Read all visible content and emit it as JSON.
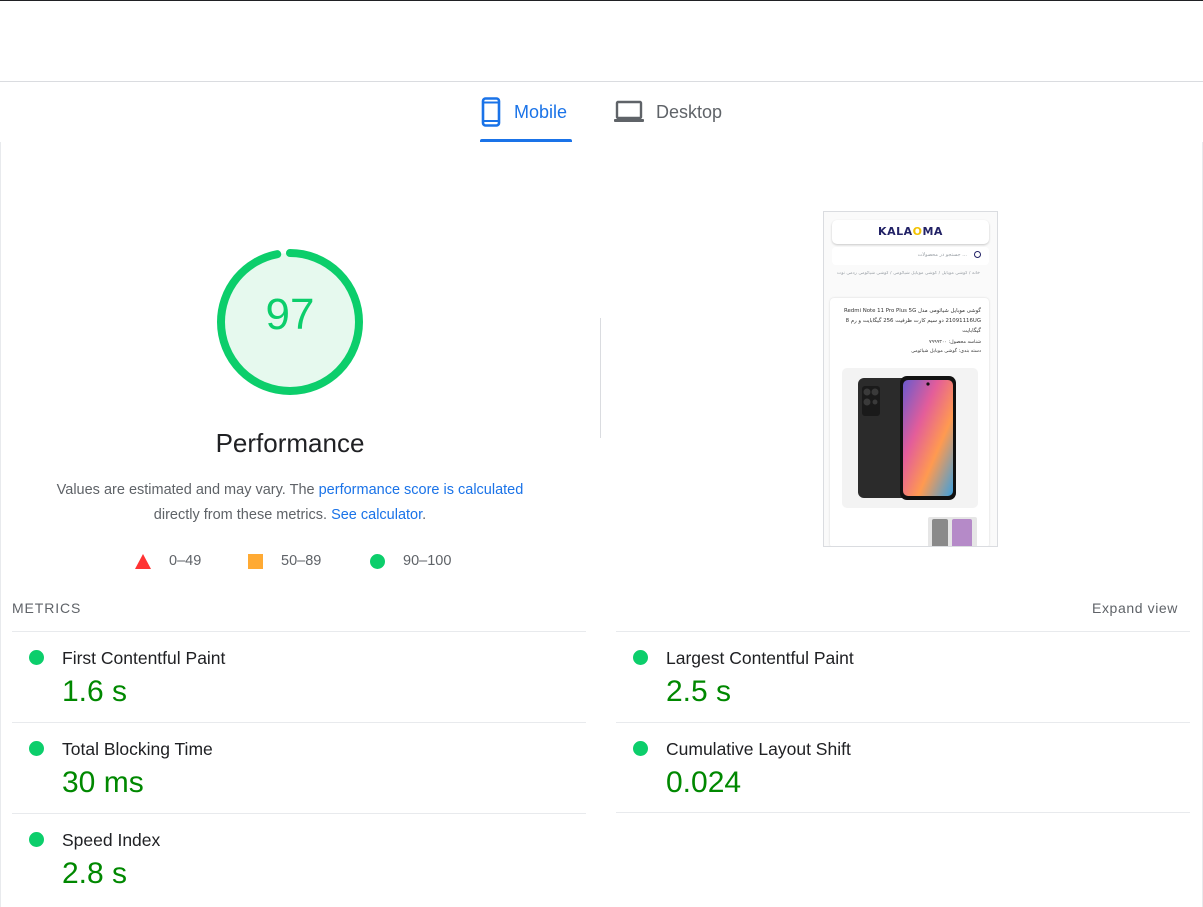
{
  "tabs": [
    {
      "label": "Mobile",
      "icon": "phone-icon",
      "active": true
    },
    {
      "label": "Desktop",
      "icon": "laptop-icon",
      "active": false
    }
  ],
  "gauge": {
    "score": "97",
    "label": "Performance",
    "color": "#0cce6b",
    "fill_fraction": 0.97
  },
  "description": {
    "part1": "Values are estimated and may vary. The ",
    "link1": "performance score is calculated",
    "part2": " directly from these metrics. ",
    "link2": "See calculator",
    "part3": "."
  },
  "legend": [
    {
      "range": "0–49",
      "shape": "triangle",
      "color": "#ff3333"
    },
    {
      "range": "50–89",
      "shape": "square",
      "color": "#ffaa33"
    },
    {
      "range": "90–100",
      "shape": "circle",
      "color": "#0cce6b"
    }
  ],
  "screenshot_thumb": {
    "logo_main": "KALA",
    "logo_dot": "O",
    "logo_end": "MA",
    "search_placeholder": "جستجو در محصولات ...",
    "breadcrumb": "خانه / گوشی موبایل / گوشی موبایل شیائومی / گوشی شیائومی ردمی نوت",
    "title": "گوشی موبایل شیائومی مدل Redmi Note 11 Pro Plus 5G 21091116UG دو سیم کارت ظرفیت 256 گیگابایت و رم 8 گیگابایت",
    "meta_line1": "شناسه محصول: ۷۹۹۹۳۰۰",
    "meta_line2": "دسته بندی: گوشی موبایل شیائومی"
  },
  "metrics_section": {
    "title": "METRICS",
    "expand": "Expand view"
  },
  "metrics": {
    "left": [
      {
        "name": "First Contentful Paint",
        "value": "1.6 s",
        "status": "pass"
      },
      {
        "name": "Total Blocking Time",
        "value": "30 ms",
        "status": "pass"
      },
      {
        "name": "Speed Index",
        "value": "2.8 s",
        "status": "pass"
      }
    ],
    "right": [
      {
        "name": "Largest Contentful Paint",
        "value": "2.5 s",
        "status": "pass"
      },
      {
        "name": "Cumulative Layout Shift",
        "value": "0.024",
        "status": "pass"
      }
    ]
  },
  "colors": {
    "accent": "#1a73e8",
    "pass": "#0cce6b",
    "value_green": "#008800"
  }
}
